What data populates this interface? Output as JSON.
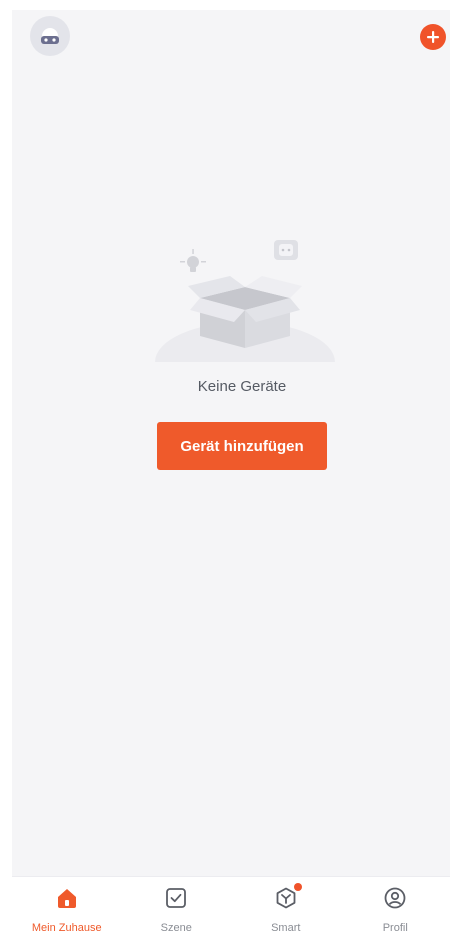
{
  "header": {
    "avatar_icon": "user-avatar-icon",
    "add_icon": "plus-icon",
    "accent_color": "#f0532a"
  },
  "empty_state": {
    "illustration": "empty-box-icon",
    "message": "Keine Geräte",
    "button_label": "Gerät hinzufügen"
  },
  "tabbar": {
    "tabs": [
      {
        "label": "Mein Zuhause",
        "icon": "home-icon",
        "active": true
      },
      {
        "label": "Szene",
        "icon": "scene-checkbox-icon",
        "active": false
      },
      {
        "label": "Smart",
        "icon": "smart-icon",
        "active": false,
        "badge": true
      },
      {
        "label": "Profil",
        "icon": "profile-icon",
        "active": false
      }
    ]
  },
  "colors": {
    "accent": "#ef5a2b",
    "background": "#f5f5f7",
    "inactive_text": "#8a8d94"
  }
}
